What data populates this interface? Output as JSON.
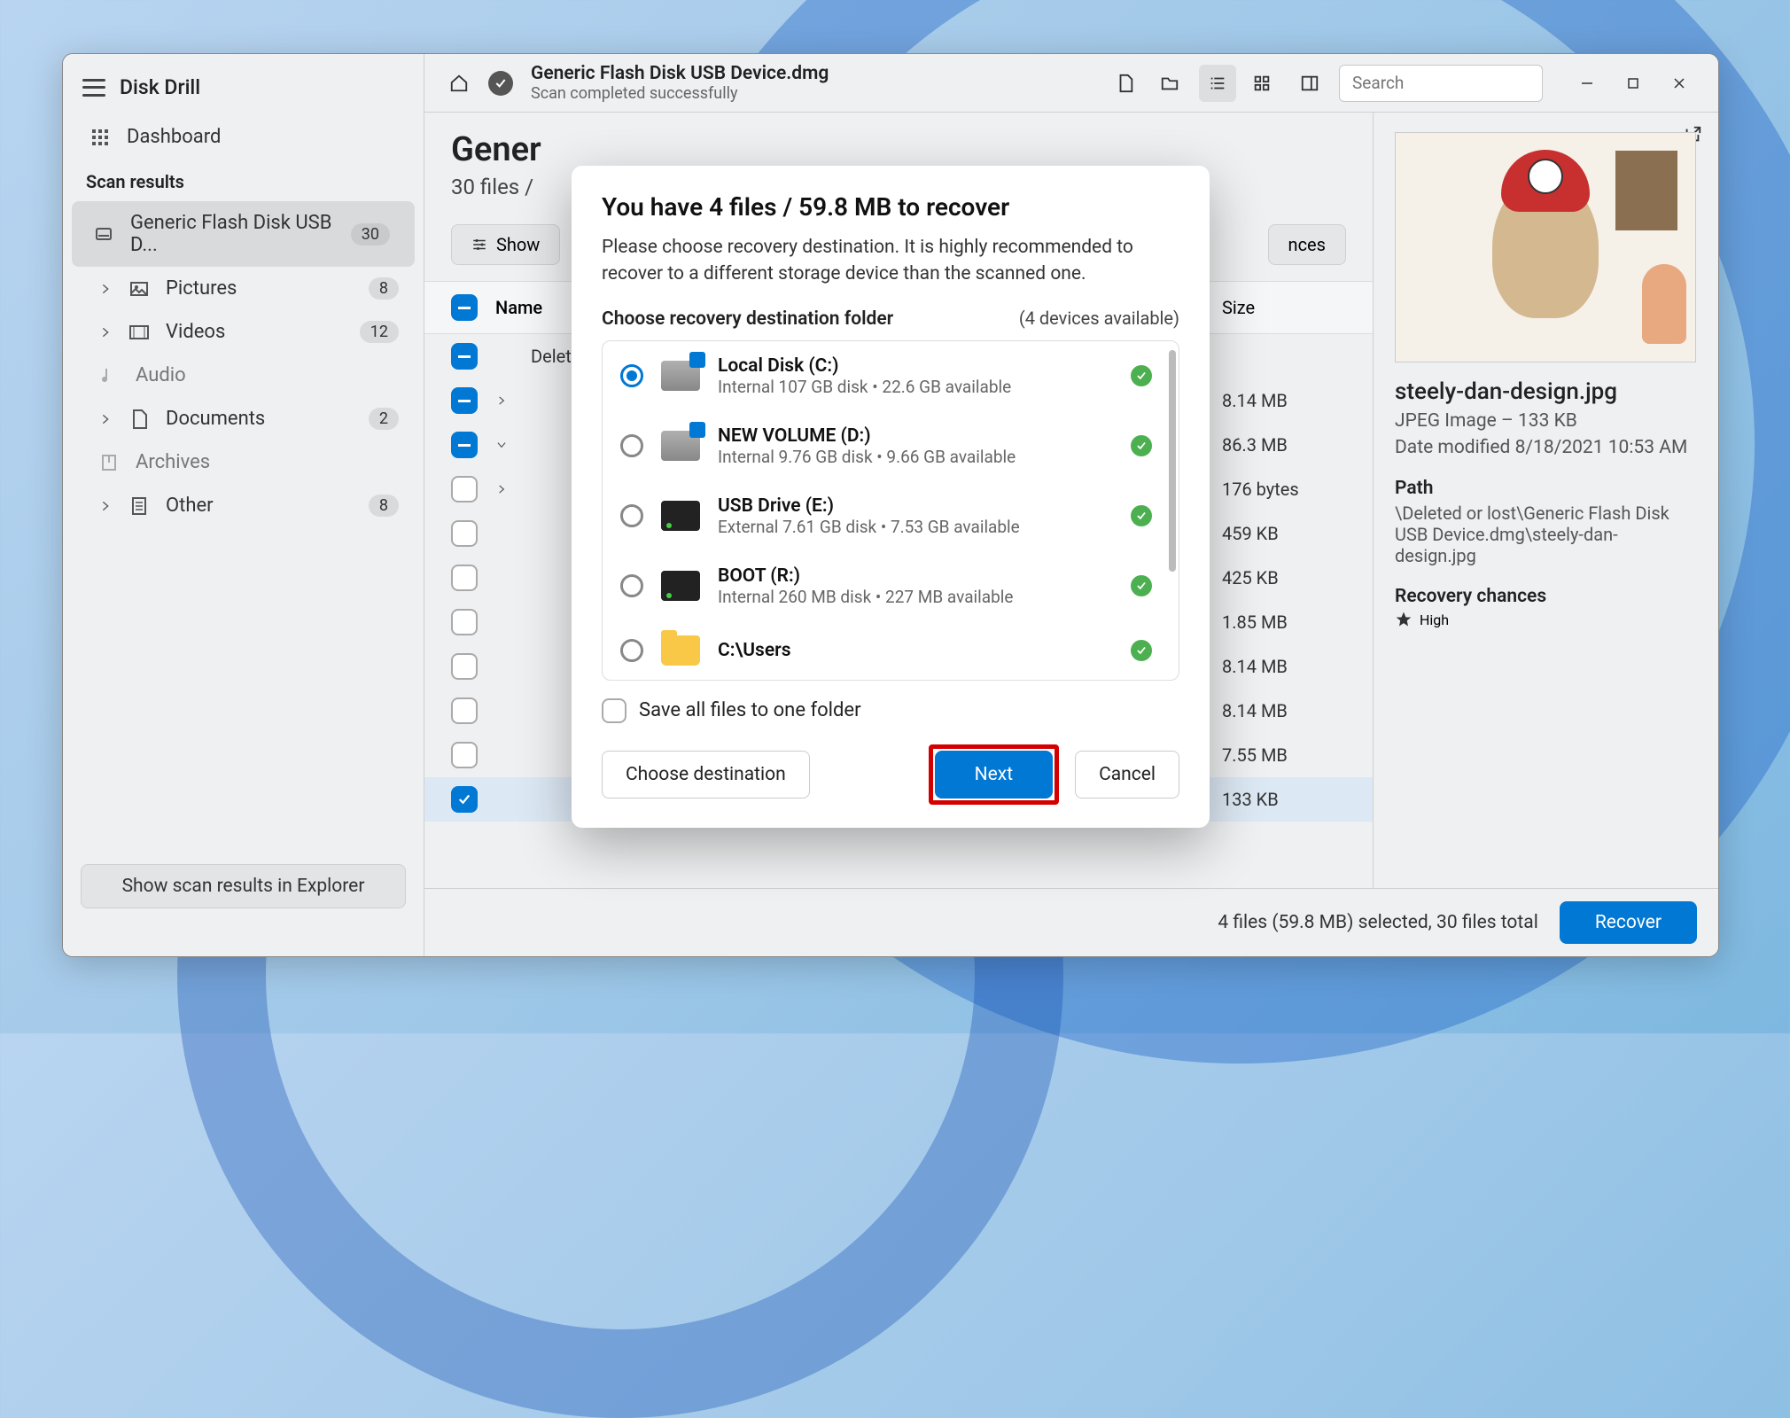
{
  "app": {
    "title": "Disk Drill"
  },
  "sidebar": {
    "dashboard": "Dashboard",
    "section": "Scan results",
    "items": [
      {
        "label": "Generic Flash Disk USB D...",
        "count": "30",
        "icon": "disk",
        "active": true
      },
      {
        "label": "Pictures",
        "count": "8",
        "icon": "image",
        "expandable": true
      },
      {
        "label": "Videos",
        "count": "12",
        "icon": "video",
        "expandable": true
      },
      {
        "label": "Audio",
        "count": "",
        "icon": "audio",
        "child": true
      },
      {
        "label": "Documents",
        "count": "2",
        "icon": "document",
        "expandable": true
      },
      {
        "label": "Archives",
        "count": "",
        "icon": "archive",
        "child": true
      },
      {
        "label": "Other",
        "count": "8",
        "icon": "other",
        "expandable": true
      }
    ],
    "show_explorer": "Show scan results in Explorer"
  },
  "toolbar": {
    "title": "Generic Flash Disk USB Device.dmg",
    "subtitle": "Scan completed successfully",
    "search_placeholder": "Search"
  },
  "content": {
    "title": "Gener",
    "subtitle": "30 files /",
    "filter_show": "Show",
    "filter_chances": "nces",
    "col_name": "Name",
    "col_size": "Size"
  },
  "file_rows": [
    {
      "check": "indeterminate",
      "expand": "",
      "name": "Delet",
      "size": ""
    },
    {
      "check": "indeterminate",
      "expand": "right",
      "name": "",
      "size": "8.14 MB"
    },
    {
      "check": "indeterminate",
      "expand": "down",
      "name": "",
      "size": "86.3 MB"
    },
    {
      "check": "empty",
      "expand": "right",
      "name": "",
      "size": "176 bytes"
    },
    {
      "check": "empty",
      "expand": "",
      "name": "",
      "size": "459 KB"
    },
    {
      "check": "empty",
      "expand": "",
      "name": "",
      "size": "425 KB"
    },
    {
      "check": "empty",
      "expand": "",
      "name": "",
      "size": "1.85 MB"
    },
    {
      "check": "empty",
      "expand": "",
      "name": "",
      "size": "8.14 MB"
    },
    {
      "check": "empty",
      "expand": "",
      "name": "",
      "size": "8.14 MB"
    },
    {
      "check": "empty",
      "expand": "",
      "name": "",
      "size": "7.55 MB"
    },
    {
      "check": "checked",
      "expand": "",
      "name": "",
      "size": "133 KB",
      "selected": true
    }
  ],
  "preview": {
    "filename": "steely-dan-design.jpg",
    "type_line": "JPEG Image – 133 KB",
    "modified": "Date modified 8/18/2021 10:53 AM",
    "path_label": "Path",
    "path_value": "\\Deleted or lost\\Generic Flash Disk USB Device.dmg\\steely-dan-design.jpg",
    "chances_label": "Recovery chances",
    "chances_value": "High"
  },
  "footer": {
    "status": "4 files (59.8 MB) selected, 30 files total",
    "recover": "Recover"
  },
  "modal": {
    "title": "You have 4 files / 59.8 MB to recover",
    "desc": "Please choose recovery destination. It is highly recommended to recover to a different storage device than the scanned one.",
    "choose_title": "Choose recovery destination folder",
    "devices_available": "(4 devices available)",
    "destinations": [
      {
        "name": "Local Disk (C:)",
        "detail": "Internal 107 GB disk • 22.6 GB available",
        "icon": "internal",
        "selected": true
      },
      {
        "name": "NEW VOLUME (D:)",
        "detail": "Internal 9.76 GB disk • 9.66 GB available",
        "icon": "internal",
        "selected": false
      },
      {
        "name": "USB Drive (E:)",
        "detail": "External 7.61 GB disk • 7.53 GB available",
        "icon": "external",
        "selected": false
      },
      {
        "name": "BOOT (R:)",
        "detail": "Internal 260 MB disk • 227 MB available",
        "icon": "external",
        "selected": false
      },
      {
        "name": "C:\\Users",
        "detail": "",
        "icon": "folder",
        "selected": false
      }
    ],
    "save_one": "Save all files to one folder",
    "choose_dest": "Choose destination",
    "next": "Next",
    "cancel": "Cancel"
  }
}
